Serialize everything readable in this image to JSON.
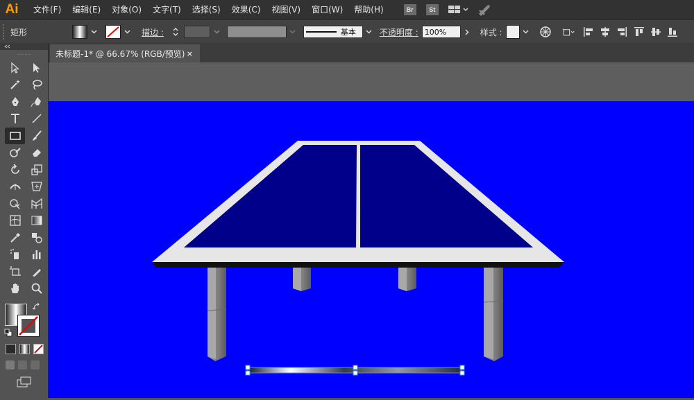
{
  "app": {
    "logo": "Ai"
  },
  "menu": {
    "items": [
      "文件(F)",
      "编辑(E)",
      "对象(O)",
      "文字(T)",
      "选择(S)",
      "效果(C)",
      "视图(V)",
      "窗口(W)",
      "帮助(H)"
    ],
    "badges": [
      "Br",
      "St"
    ]
  },
  "control": {
    "object_type": "矩形",
    "stroke_label": "描边 :",
    "opacity_label": "不透明度 :",
    "opacity_value": "100%",
    "brush_label": "基本",
    "style_label": "样式 :"
  },
  "document": {
    "tab_title": "未标题-1* @ 66.67% (RGB/预览)",
    "close_glyph": "×"
  },
  "colors": {
    "artboard": "#0000ff",
    "table_surface": "#00008b",
    "table_border": "#e6e6e6",
    "accent_logo": "#ff9a00"
  }
}
